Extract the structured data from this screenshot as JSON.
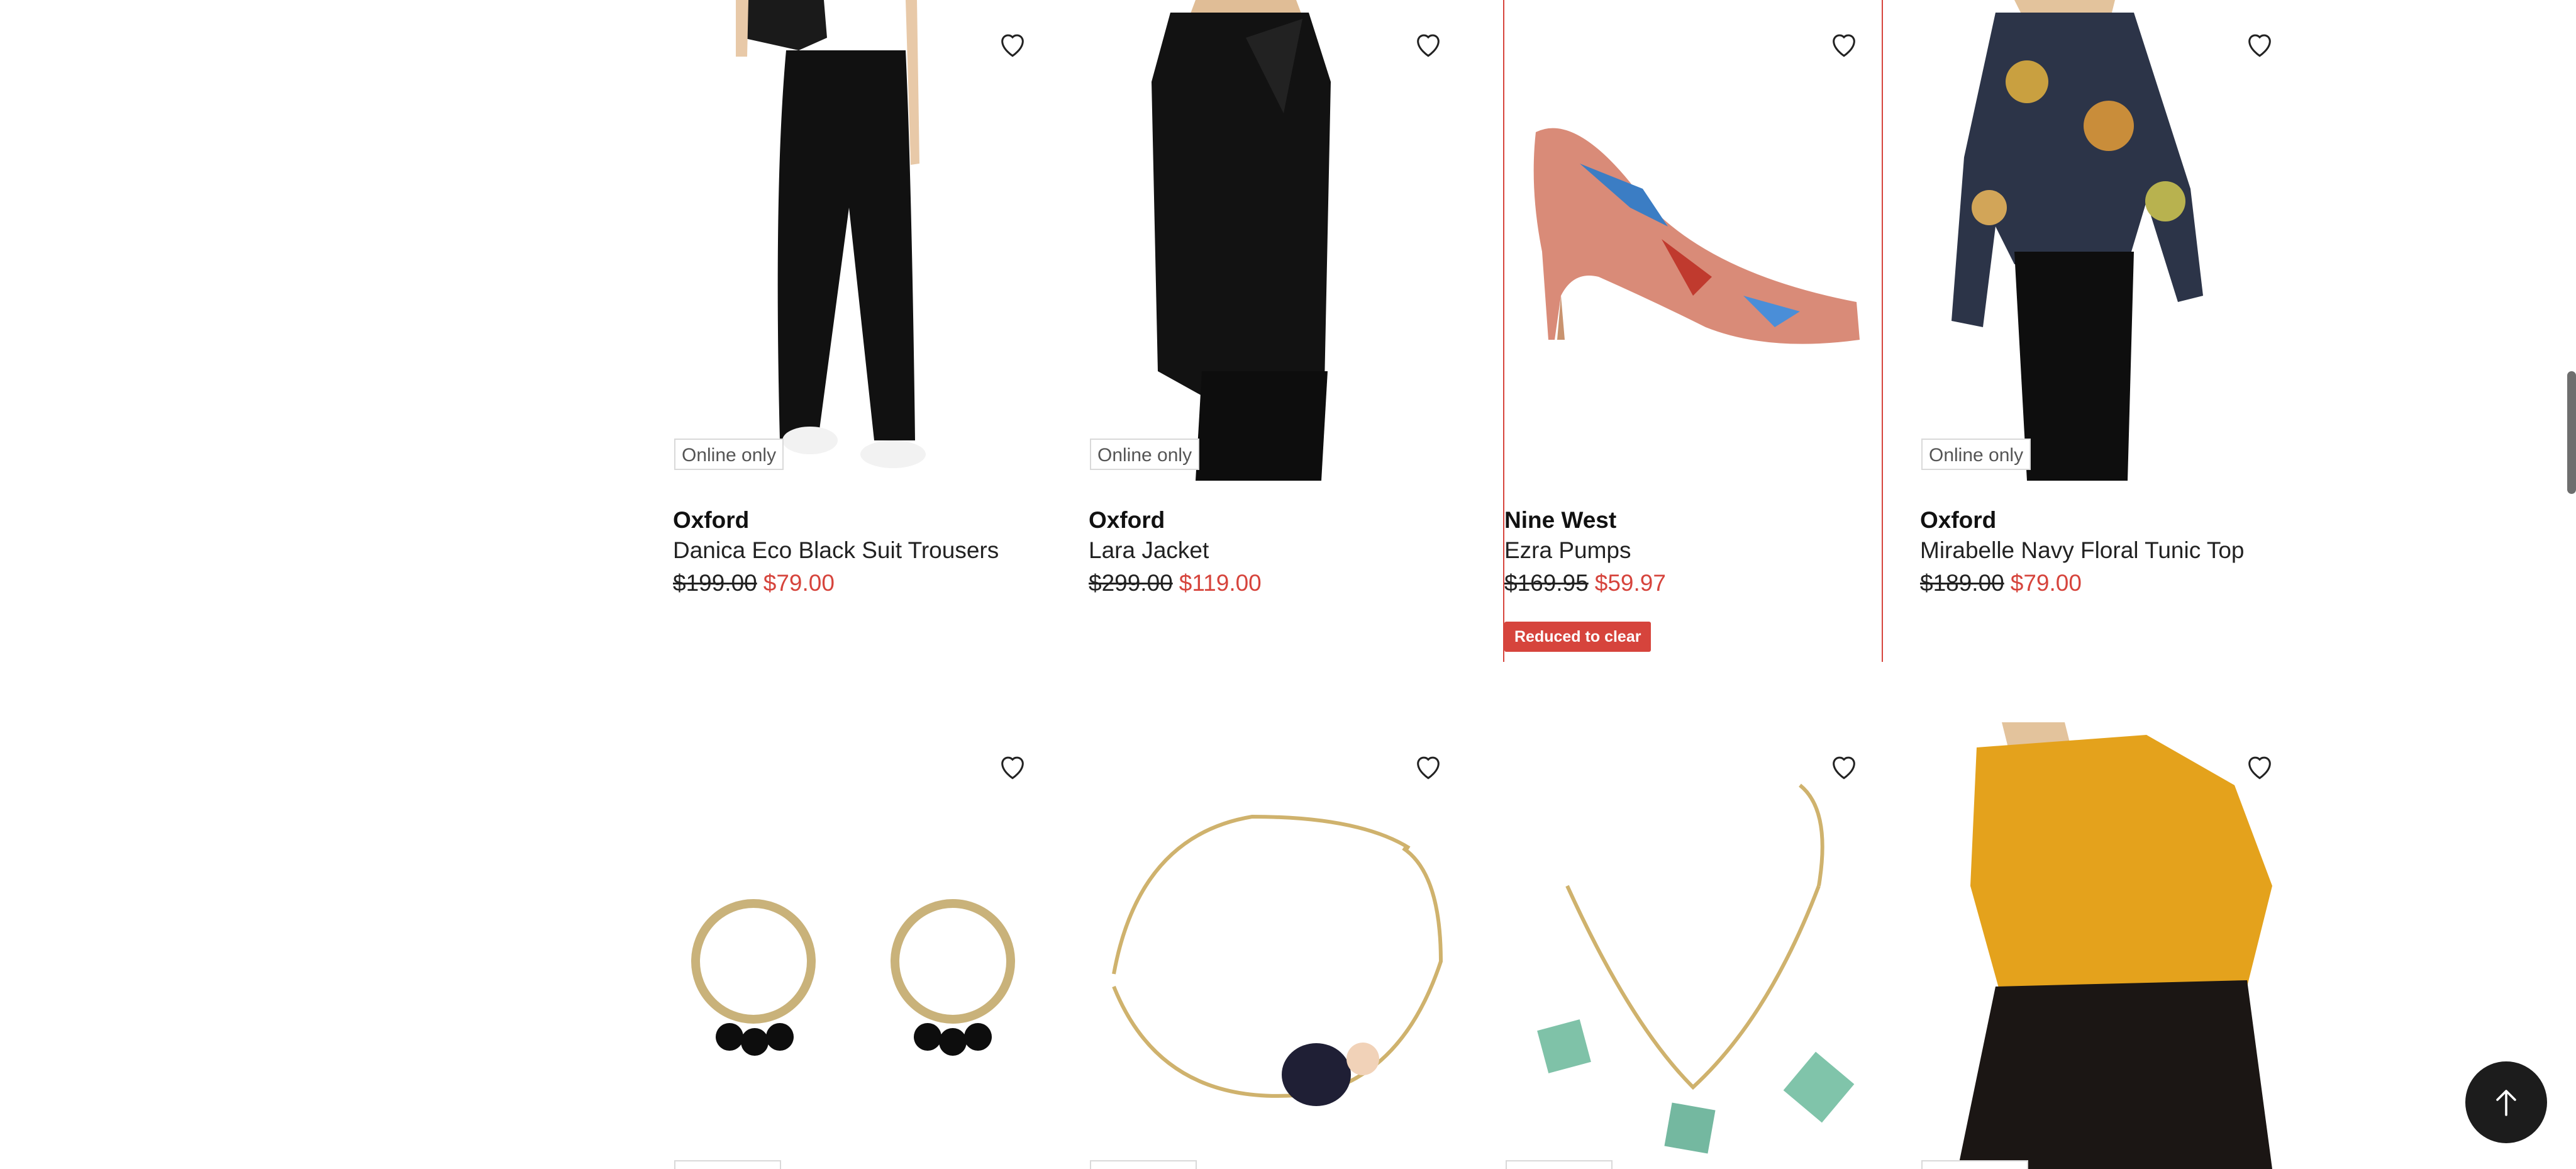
{
  "products_row1": [
    {
      "brand": "Oxford",
      "name": "Danica Eco Black Suit Trousers",
      "was": "$199.00",
      "now": "$79.00",
      "badge": "Online only",
      "tag": ""
    },
    {
      "brand": "Oxford",
      "name": "Lara Jacket",
      "was": "$299.00",
      "now": "$119.00",
      "badge": "Online only",
      "tag": ""
    },
    {
      "brand": "Nine West",
      "name": "Ezra Pumps",
      "was": "$169.95",
      "now": "$59.97",
      "badge": "",
      "tag": "Reduced to clear"
    },
    {
      "brand": "Oxford",
      "name": "Mirabelle Navy Floral Tunic Top",
      "was": "$189.00",
      "now": "$79.00",
      "badge": "Online only",
      "tag": ""
    }
  ],
  "colors": {
    "accent": "#d6443c",
    "text": "#222222",
    "badge_border": "#d9d9d9",
    "back_to_top": "#1c1c1c"
  },
  "icons": {
    "wishlist": "heart-outline-icon",
    "back_to_top": "arrow-up-icon"
  }
}
